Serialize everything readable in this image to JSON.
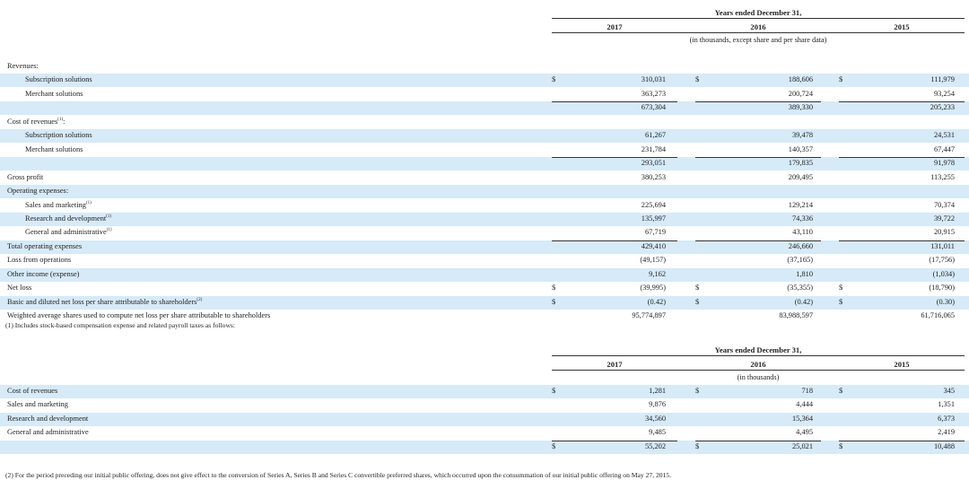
{
  "table1": {
    "header_group": "Years ended December 31,",
    "years": [
      "2017",
      "2016",
      "2015"
    ],
    "unit_note": "(in thousands, except share and per share data)",
    "rows": [
      {
        "label": "Revenues:",
        "indent": 0,
        "blue": false,
        "dollar": false,
        "v": [
          "",
          "",
          ""
        ]
      },
      {
        "label": "Subscription solutions",
        "indent": 1,
        "blue": true,
        "dollar": true,
        "v": [
          "310,031",
          "188,606",
          "111,979"
        ]
      },
      {
        "label": "Merchant solutions",
        "indent": 1,
        "blue": false,
        "dollar": false,
        "v": [
          "363,273",
          "200,724",
          "93,254"
        ]
      },
      {
        "label": "",
        "indent": 0,
        "blue": true,
        "dollar": false,
        "v": [
          "673,304",
          "389,330",
          "205,233"
        ]
      },
      {
        "label": "Cost of revenues",
        "sup": "(1)",
        "suffix": ":",
        "indent": 0,
        "blue": false,
        "dollar": false,
        "v": [
          "",
          "",
          ""
        ]
      },
      {
        "label": "Subscription solutions",
        "indent": 1,
        "blue": true,
        "dollar": false,
        "v": [
          "61,267",
          "39,478",
          "24,531"
        ]
      },
      {
        "label": "Merchant solutions",
        "indent": 1,
        "blue": false,
        "dollar": false,
        "v": [
          "231,784",
          "140,357",
          "67,447"
        ]
      },
      {
        "label": "",
        "indent": 0,
        "blue": true,
        "dollar": false,
        "v": [
          "293,051",
          "179,835",
          "91,978"
        ]
      },
      {
        "label": "Gross profit",
        "indent": 0,
        "blue": false,
        "dollar": false,
        "v": [
          "380,253",
          "209,495",
          "113,255"
        ]
      },
      {
        "label": "Operating expenses:",
        "indent": 0,
        "blue": true,
        "dollar": false,
        "v": [
          "",
          "",
          ""
        ]
      },
      {
        "label": "Sales and marketing",
        "sup": "(1)",
        "indent": 1,
        "blue": false,
        "dollar": false,
        "v": [
          "225,694",
          "129,214",
          "70,374"
        ]
      },
      {
        "label": "Research and development",
        "sup": "(1)",
        "indent": 1,
        "blue": true,
        "dollar": false,
        "v": [
          "135,997",
          "74,336",
          "39,722"
        ]
      },
      {
        "label": "General and administrative",
        "sup": "(1)",
        "indent": 1,
        "blue": false,
        "dollar": false,
        "v": [
          "67,719",
          "43,110",
          "20,915"
        ]
      },
      {
        "label": "Total operating expenses",
        "indent": 0,
        "blue": true,
        "dollar": false,
        "v": [
          "429,410",
          "246,660",
          "131,011"
        ]
      },
      {
        "label": "Loss from operations",
        "indent": 0,
        "blue": false,
        "dollar": false,
        "v": [
          "(49,157)",
          "(37,165)",
          "(17,756)"
        ]
      },
      {
        "label": "Other income (expense)",
        "indent": 0,
        "blue": true,
        "dollar": false,
        "v": [
          "9,162",
          "1,810",
          "(1,034)"
        ]
      },
      {
        "label": "Net loss",
        "indent": 0,
        "blue": false,
        "dollar": true,
        "v": [
          "(39,995)",
          "(35,355)",
          "(18,790)"
        ]
      },
      {
        "label": "Basic and diluted net loss per share attributable to shareholders",
        "sup": "(2)",
        "indent": 0,
        "blue": true,
        "dollar": true,
        "v": [
          "(0.42)",
          "(0.42)",
          "(0.30)"
        ]
      },
      {
        "label": "Weighted average shares used to compute net loss per share attributable to shareholders",
        "indent": 0,
        "blue": false,
        "dollar": false,
        "v": [
          "95,774,897",
          "83,988,597",
          "61,716,065"
        ]
      }
    ]
  },
  "footnote1": "(1) Includes stock-based compensation expense and related payroll taxes as follows:",
  "table2": {
    "header_group": "Years ended December 31,",
    "years": [
      "2017",
      "2016",
      "2015"
    ],
    "unit_note": "(in thousands)",
    "rows": [
      {
        "label": "Cost of revenues",
        "indent": 0,
        "blue": true,
        "dollar": true,
        "v": [
          "1,281",
          "718",
          "345"
        ]
      },
      {
        "label": "Sales and marketing",
        "indent": 0,
        "blue": false,
        "dollar": false,
        "v": [
          "9,876",
          "4,444",
          "1,351"
        ]
      },
      {
        "label": "Research and development",
        "indent": 0,
        "blue": true,
        "dollar": false,
        "v": [
          "34,560",
          "15,364",
          "6,373"
        ]
      },
      {
        "label": "General and administrative",
        "indent": 0,
        "blue": false,
        "dollar": false,
        "v": [
          "9,485",
          "4,495",
          "2,419"
        ]
      },
      {
        "label": "",
        "indent": 0,
        "blue": true,
        "dollar": true,
        "v": [
          "55,202",
          "25,021",
          "10,488"
        ]
      }
    ]
  },
  "dollar_sign": "$",
  "footnote2": "(2) For the period preceding our initial public offering, does not give effect to the conversion of Series A, Series B and Series C convertible preferred shares, which occurred upon the consummation of our initial public offering on May 27, 2015."
}
